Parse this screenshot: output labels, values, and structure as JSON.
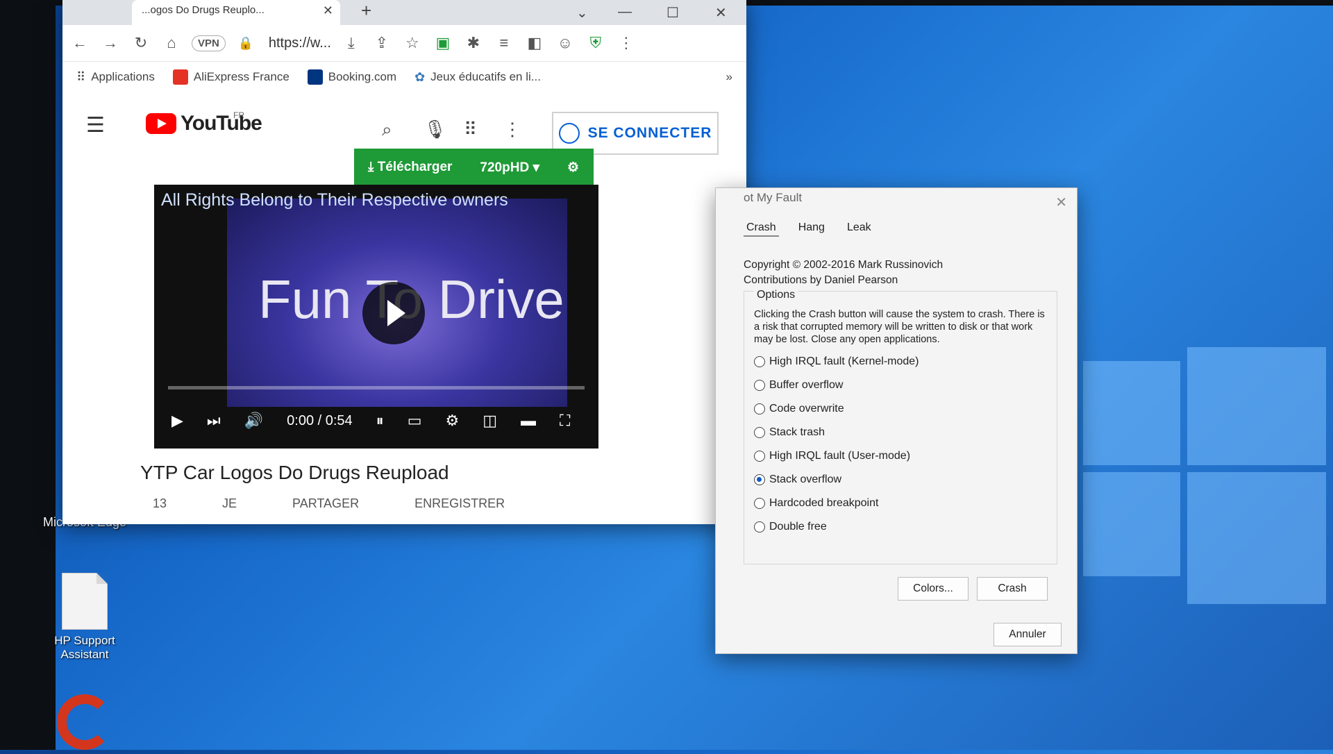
{
  "browser": {
    "tab_title": "...ogos Do Drugs Reuplo...",
    "url": "https://w...",
    "vpn_label": "VPN",
    "bookmarks": [
      {
        "label": "Applications",
        "icon": "apps-grid-icon"
      },
      {
        "label": "AliExpress France",
        "icon": "aliexpress-icon"
      },
      {
        "label": "Booking.com",
        "icon": "booking-icon"
      },
      {
        "label": "Jeux éducatifs en li...",
        "icon": "jeux-icon"
      }
    ],
    "more_bookmarks": "»"
  },
  "youtube": {
    "logo_text": "YouTube",
    "region": "FR",
    "signin_label": "SE CONNECTER",
    "download_label": "Télécharger",
    "quality_label": "720pHD",
    "video_overlay_title": "All Rights Belong to Their Respective owners",
    "video_frame_text": "Fun To Drive",
    "time_display": "0:00 / 0:54",
    "progress_fraction": 0.0,
    "video_title": "YTP Car Logos Do Drugs Reupload",
    "actions": [
      "13",
      "JE",
      "PARTAGER",
      "ENREGISTRER"
    ]
  },
  "desktop": {
    "icons": [
      {
        "label": "Microsoft Edge"
      },
      {
        "label": "HP Support Assistant"
      }
    ]
  },
  "dialog": {
    "title": "ot My Fault",
    "tabs": [
      "Crash",
      "Hang",
      "Leak"
    ],
    "copyright": "Copyright © 2002-2016 Mark Russinovich",
    "contributions": "Contributions by Daniel Pearson",
    "options_legend": "Options",
    "warning": "Clicking the Crash button will cause the system to crash. There is a risk that corrupted memory will be written to disk or that work may be lost. Close any open applications.",
    "options": [
      {
        "label": "High IRQL fault (Kernel-mode)",
        "selected": false
      },
      {
        "label": "Buffer overflow",
        "selected": false
      },
      {
        "label": "Code overwrite",
        "selected": false
      },
      {
        "label": "Stack trash",
        "selected": false
      },
      {
        "label": "High IRQL fault (User-mode)",
        "selected": false
      },
      {
        "label": "Stack overflow",
        "selected": true
      },
      {
        "label": "Hardcoded breakpoint",
        "selected": false
      },
      {
        "label": "Double free",
        "selected": false
      }
    ],
    "colors_button": "Colors...",
    "crash_button": "Crash",
    "cancel_button": "Annuler"
  },
  "colors": {
    "youtube_red": "#ff0000",
    "download_green": "#1e9a36",
    "link_blue": "#065fd4",
    "desktop_blue": "#1668c9"
  }
}
